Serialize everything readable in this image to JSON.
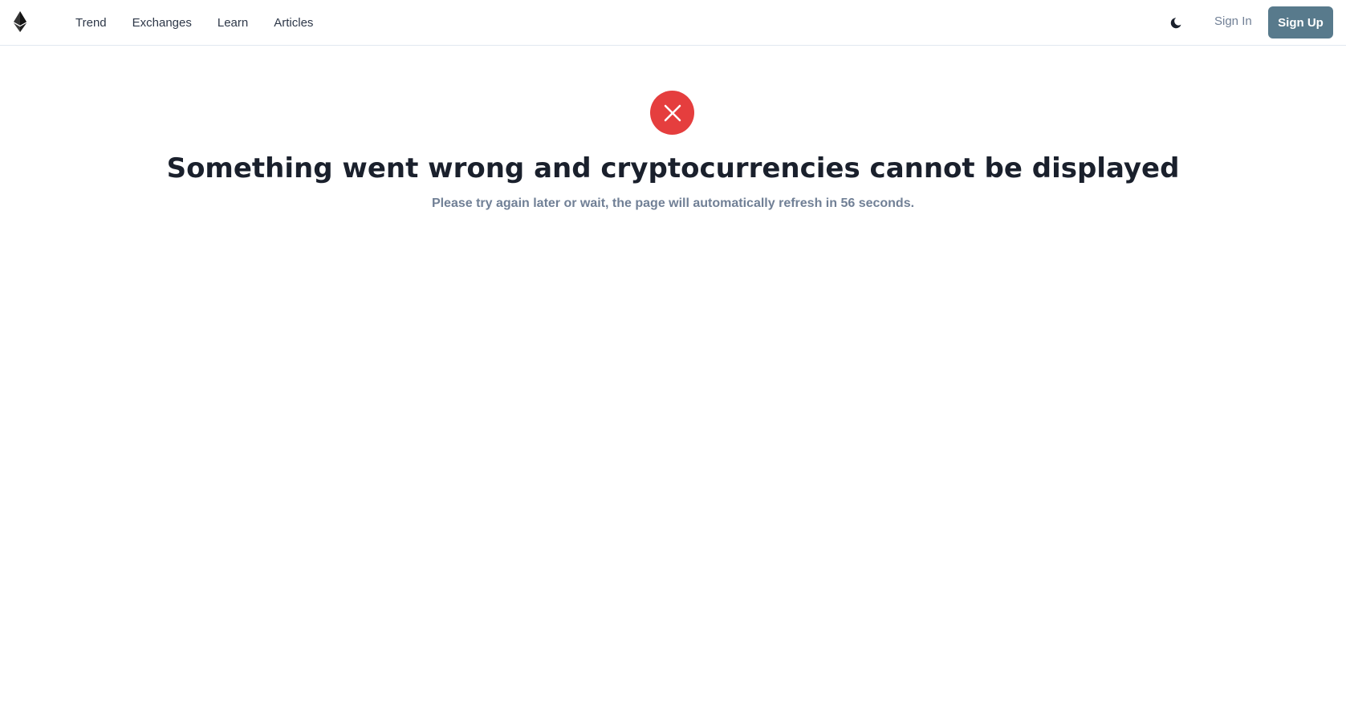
{
  "header": {
    "logo_icon": "ethereum-diamond-icon",
    "nav": [
      {
        "label": "Trend"
      },
      {
        "label": "Exchanges"
      },
      {
        "label": "Learn"
      },
      {
        "label": "Articles"
      }
    ],
    "theme_icon": "moon-icon",
    "signin_label": "Sign In",
    "signup_label": "Sign Up"
  },
  "error": {
    "icon": "close-icon",
    "title": "Something went wrong and cryptocurrencies cannot be displayed",
    "subtitle": "Please try again later or wait, the page will automatically refresh in 56 seconds."
  },
  "colors": {
    "accent": "#587a8c",
    "error": "#e53e3e",
    "text": "#1a202c",
    "muted": "#718096"
  }
}
